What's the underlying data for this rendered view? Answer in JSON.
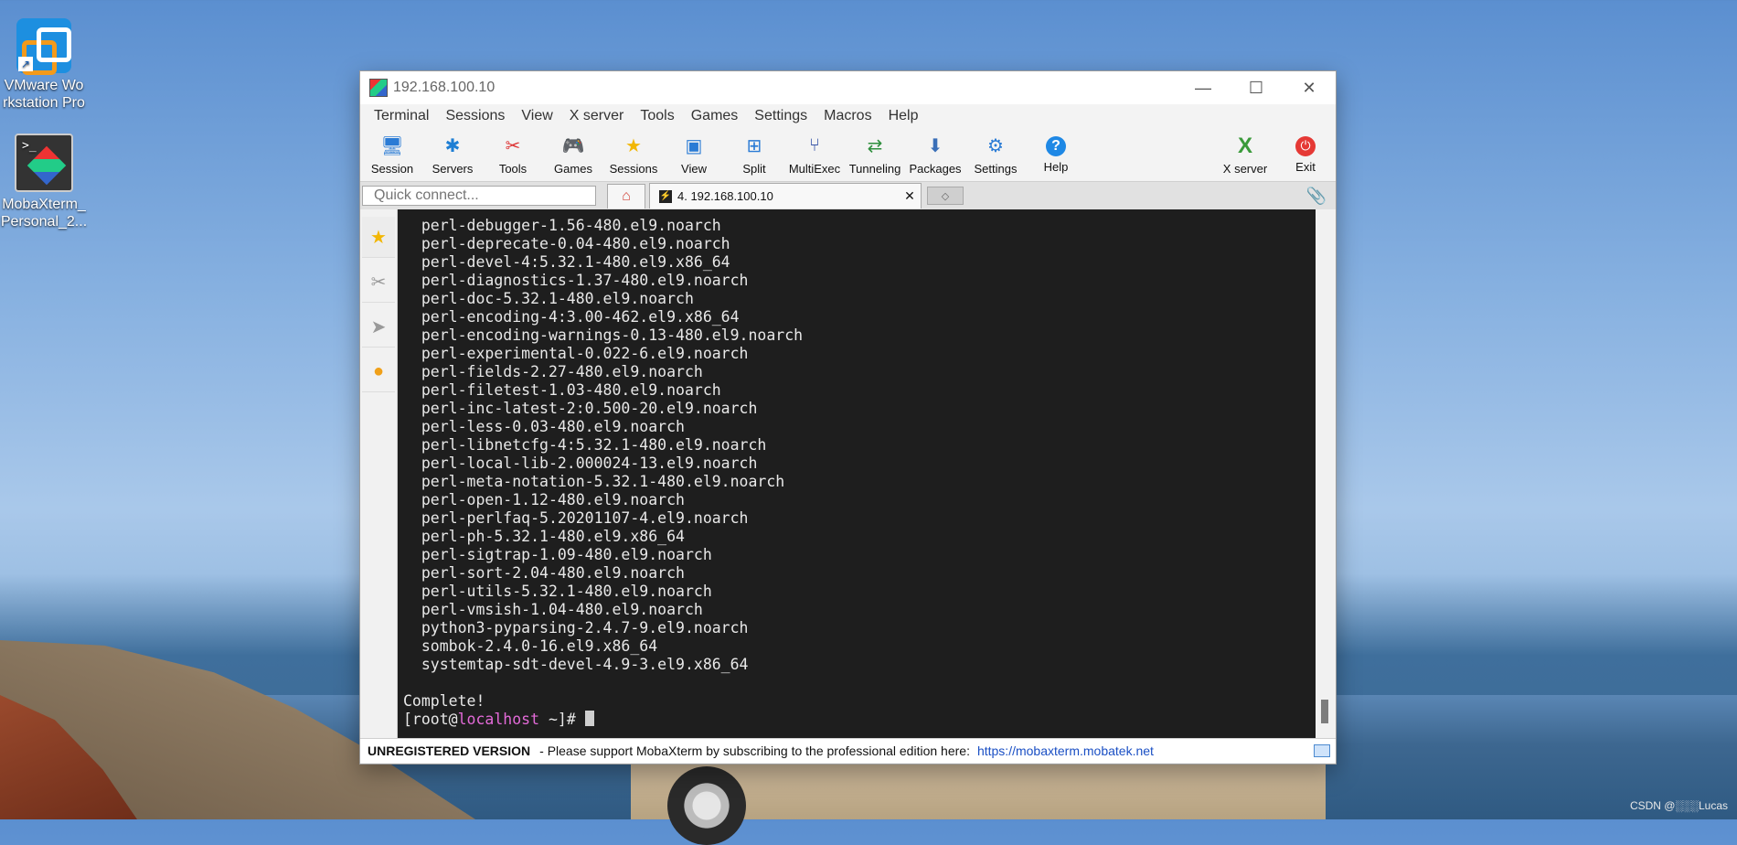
{
  "desktop": {
    "icons": [
      {
        "label_line1": "VMware Wo",
        "label_line2": "rkstation Pro"
      },
      {
        "label_line1": "MobaXterm_",
        "label_line2": "Personal_2..."
      }
    ],
    "watermark": "CSDN @░░░Lucas"
  },
  "window": {
    "title": "192.168.100.10",
    "menus": [
      "Terminal",
      "Sessions",
      "View",
      "X server",
      "Tools",
      "Games",
      "Settings",
      "Macros",
      "Help"
    ],
    "toolbar": [
      {
        "label": "Session",
        "icon": "session-icon"
      },
      {
        "label": "Servers",
        "icon": "servers-icon"
      },
      {
        "label": "Tools",
        "icon": "tools-icon"
      },
      {
        "label": "Games",
        "icon": "games-icon"
      },
      {
        "label": "Sessions",
        "icon": "star-icon"
      },
      {
        "label": "View",
        "icon": "view-icon"
      },
      {
        "label": "Split",
        "icon": "split-icon"
      },
      {
        "label": "MultiExec",
        "icon": "multiexec-icon"
      },
      {
        "label": "Tunneling",
        "icon": "tunneling-icon"
      },
      {
        "label": "Packages",
        "icon": "packages-icon"
      },
      {
        "label": "Settings",
        "icon": "settings-icon"
      },
      {
        "label": "Help",
        "icon": "help-icon"
      }
    ],
    "toolbar_right": [
      {
        "label": "X server",
        "icon": "x-server-icon"
      },
      {
        "label": "Exit",
        "icon": "power-icon"
      }
    ],
    "quick_connect_placeholder": "Quick connect...",
    "session_tab": "4. 192.168.100.10",
    "terminal": {
      "lines": [
        "  perl-debugger-1.56-480.el9.noarch",
        "  perl-deprecate-0.04-480.el9.noarch",
        "  perl-devel-4:5.32.1-480.el9.x86_64",
        "  perl-diagnostics-1.37-480.el9.noarch",
        "  perl-doc-5.32.1-480.el9.noarch",
        "  perl-encoding-4:3.00-462.el9.x86_64",
        "  perl-encoding-warnings-0.13-480.el9.noarch",
        "  perl-experimental-0.022-6.el9.noarch",
        "  perl-fields-2.27-480.el9.noarch",
        "  perl-filetest-1.03-480.el9.noarch",
        "  perl-inc-latest-2:0.500-20.el9.noarch",
        "  perl-less-0.03-480.el9.noarch",
        "  perl-libnetcfg-4:5.32.1-480.el9.noarch",
        "  perl-local-lib-2.000024-13.el9.noarch",
        "  perl-meta-notation-5.32.1-480.el9.noarch",
        "  perl-open-1.12-480.el9.noarch",
        "  perl-perlfaq-5.20201107-4.el9.noarch",
        "  perl-ph-5.32.1-480.el9.x86_64",
        "  perl-sigtrap-1.09-480.el9.noarch",
        "  perl-sort-2.04-480.el9.noarch",
        "  perl-utils-5.32.1-480.el9.noarch",
        "  perl-vmsish-1.04-480.el9.noarch",
        "  python3-pyparsing-2.4.7-9.el9.noarch",
        "  sombok-2.4.0-16.el9.x86_64",
        "  systemtap-sdt-devel-4.9-3.el9.x86_64",
        "",
        "Complete!"
      ],
      "prompt_open": "[root@",
      "prompt_host": "localhost",
      "prompt_close": " ~]# "
    },
    "status": {
      "unregistered": "UNREGISTERED VERSION",
      "message": "-  Please support MobaXterm by subscribing to the professional edition here:",
      "link": "https://mobaxterm.mobatek.net"
    }
  }
}
